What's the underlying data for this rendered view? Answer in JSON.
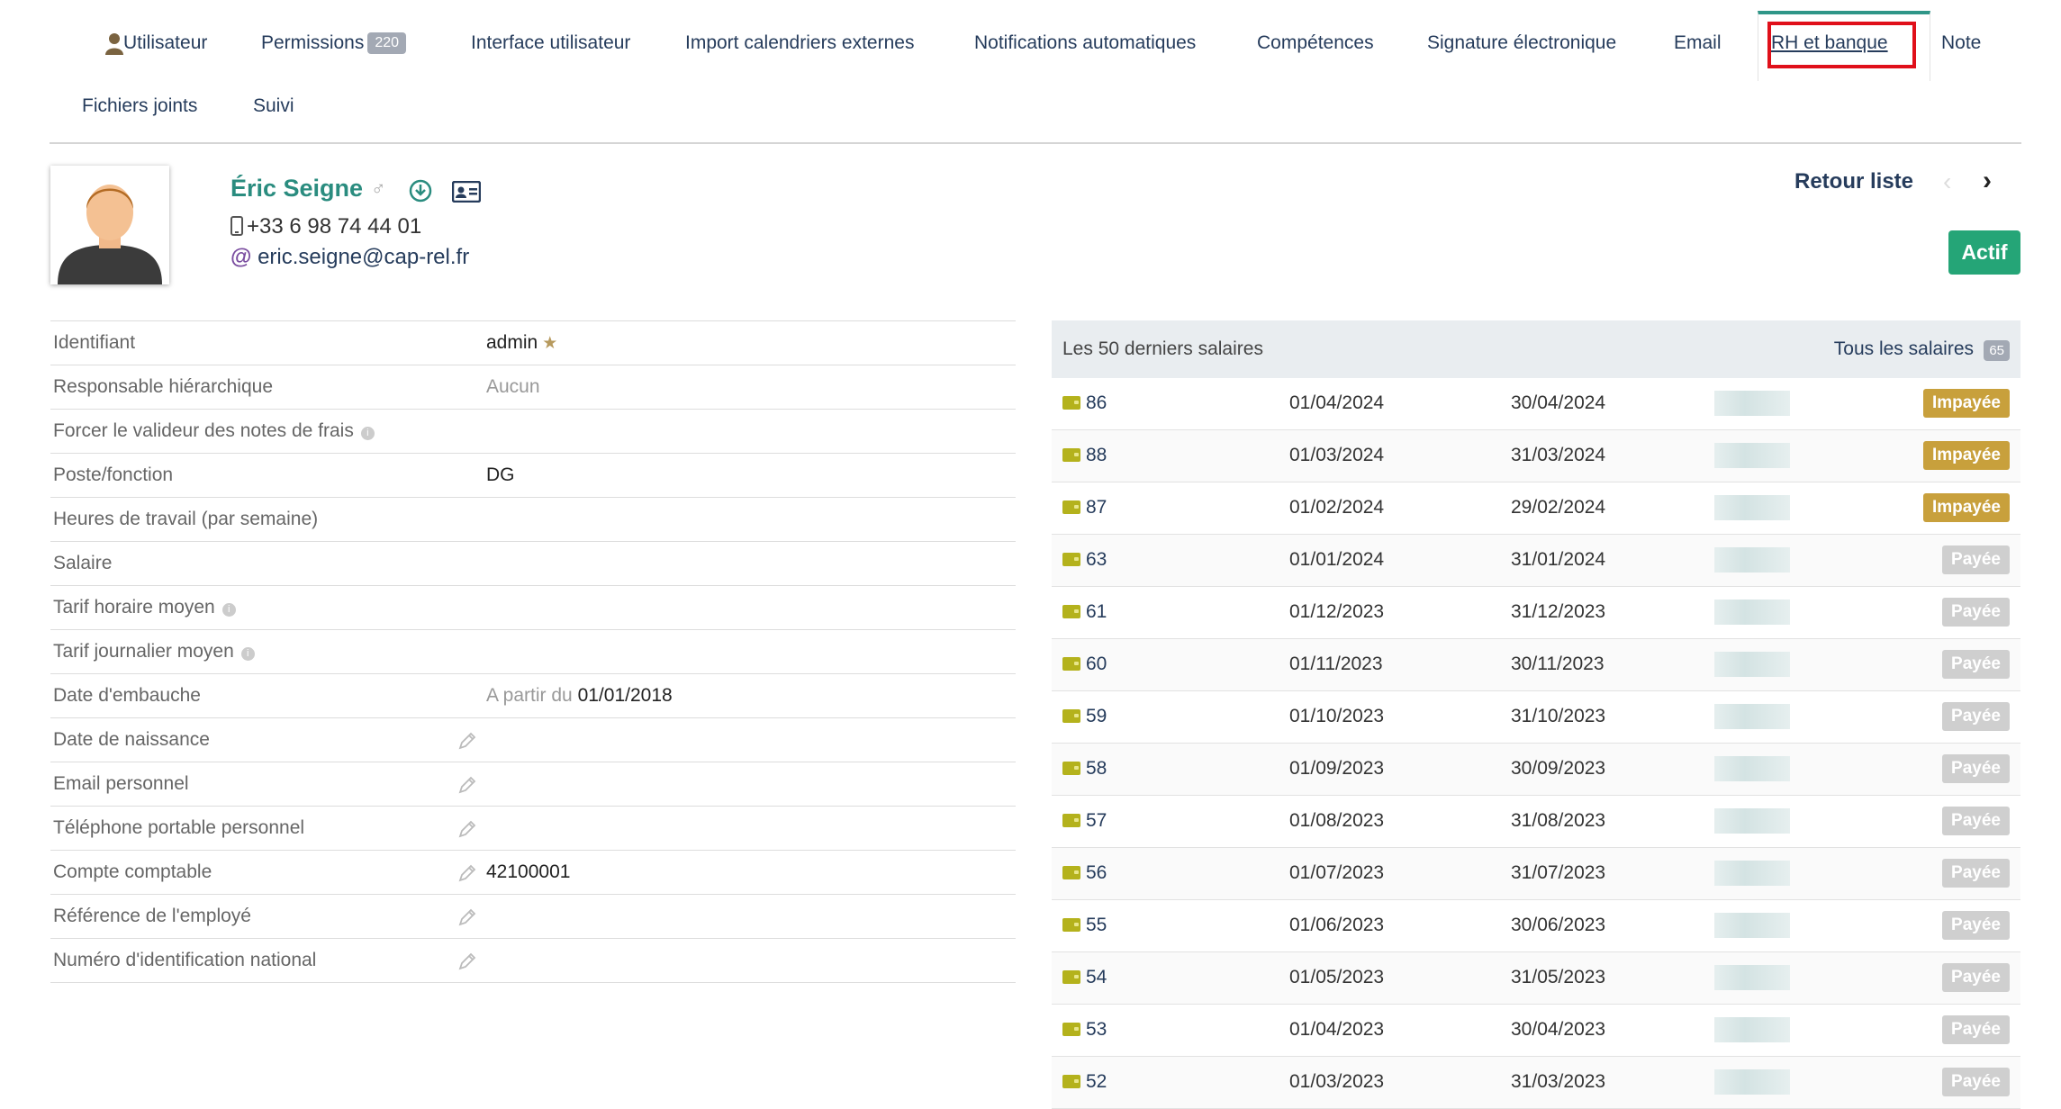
{
  "tabs": [
    {
      "label": "Utilisateur"
    },
    {
      "label": "Permissions",
      "badge": "220"
    },
    {
      "label": "Interface utilisateur"
    },
    {
      "label": "Import calendriers externes"
    },
    {
      "label": "Notifications automatiques"
    },
    {
      "label": "Compétences"
    },
    {
      "label": "Signature électronique"
    },
    {
      "label": "Email"
    },
    {
      "label": "RH et banque",
      "active": true
    },
    {
      "label": "Note"
    },
    {
      "label": "Fichiers joints"
    },
    {
      "label": "Suivi"
    }
  ],
  "user": {
    "name": "Éric Seigne",
    "gender_symbol": "♂",
    "phone": "+33 6 98 74 44 01",
    "email": "eric.seigne@cap-rel.fr",
    "status": "Actif"
  },
  "nav": {
    "back_label": "Retour liste",
    "prev": "‹",
    "next": "›"
  },
  "info": [
    {
      "label": "Identifiant",
      "value": "admin",
      "star": true
    },
    {
      "label": "Responsable hiérarchique",
      "value": "Aucun",
      "muted": true
    },
    {
      "label": "Forcer le valideur des notes de frais",
      "info": true,
      "value": ""
    },
    {
      "label": "Poste/fonction",
      "value": "DG"
    },
    {
      "label": "Heures de travail (par semaine)",
      "value": ""
    },
    {
      "label": "Salaire",
      "value": ""
    },
    {
      "label": "Tarif horaire moyen",
      "info": true,
      "value": ""
    },
    {
      "label": "Tarif journalier moyen",
      "info": true,
      "value": ""
    },
    {
      "label": "Date d'embauche",
      "prefix": "A partir du",
      "value": "01/01/2018"
    },
    {
      "label": "Date de naissance",
      "pencil": true,
      "value": ""
    },
    {
      "label": "Email personnel",
      "pencil": true,
      "value": ""
    },
    {
      "label": "Téléphone portable personnel",
      "pencil": true,
      "value": ""
    },
    {
      "label": "Compte comptable",
      "pencil": true,
      "value": "42100001"
    },
    {
      "label": "Référence de l'employé",
      "pencil": true,
      "value": ""
    },
    {
      "label": "Numéro d'identification national",
      "pencil": true,
      "value": ""
    }
  ],
  "salaries": {
    "title": "Les 50 derniers salaires",
    "all_label": "Tous les salaires",
    "count": "65",
    "rows": [
      {
        "id": "86",
        "start": "01/04/2024",
        "end": "30/04/2024",
        "status": "Impayée",
        "paid": false
      },
      {
        "id": "88",
        "start": "01/03/2024",
        "end": "31/03/2024",
        "status": "Impayée",
        "paid": false
      },
      {
        "id": "87",
        "start": "01/02/2024",
        "end": "29/02/2024",
        "status": "Impayée",
        "paid": false
      },
      {
        "id": "63",
        "start": "01/01/2024",
        "end": "31/01/2024",
        "status": "Payée",
        "paid": true
      },
      {
        "id": "61",
        "start": "01/12/2023",
        "end": "31/12/2023",
        "status": "Payée",
        "paid": true
      },
      {
        "id": "60",
        "start": "01/11/2023",
        "end": "30/11/2023",
        "status": "Payée",
        "paid": true
      },
      {
        "id": "59",
        "start": "01/10/2023",
        "end": "31/10/2023",
        "status": "Payée",
        "paid": true
      },
      {
        "id": "58",
        "start": "01/09/2023",
        "end": "30/09/2023",
        "status": "Payée",
        "paid": true
      },
      {
        "id": "57",
        "start": "01/08/2023",
        "end": "31/08/2023",
        "status": "Payée",
        "paid": true
      },
      {
        "id": "56",
        "start": "01/07/2023",
        "end": "31/07/2023",
        "status": "Payée",
        "paid": true
      },
      {
        "id": "55",
        "start": "01/06/2023",
        "end": "30/06/2023",
        "status": "Payée",
        "paid": true
      },
      {
        "id": "54",
        "start": "01/05/2023",
        "end": "31/05/2023",
        "status": "Payée",
        "paid": true
      },
      {
        "id": "53",
        "start": "01/04/2023",
        "end": "30/04/2023",
        "status": "Payée",
        "paid": true
      },
      {
        "id": "52",
        "start": "01/03/2023",
        "end": "31/03/2023",
        "status": "Payée",
        "paid": true
      }
    ]
  },
  "colors": {
    "accent": "#2a8c7f",
    "active_tab_border": "#2f9688",
    "highlight": "#e0101a",
    "unpaid": "#c8a03c",
    "paid": "#cfcfcf",
    "actif": "#25a577"
  }
}
